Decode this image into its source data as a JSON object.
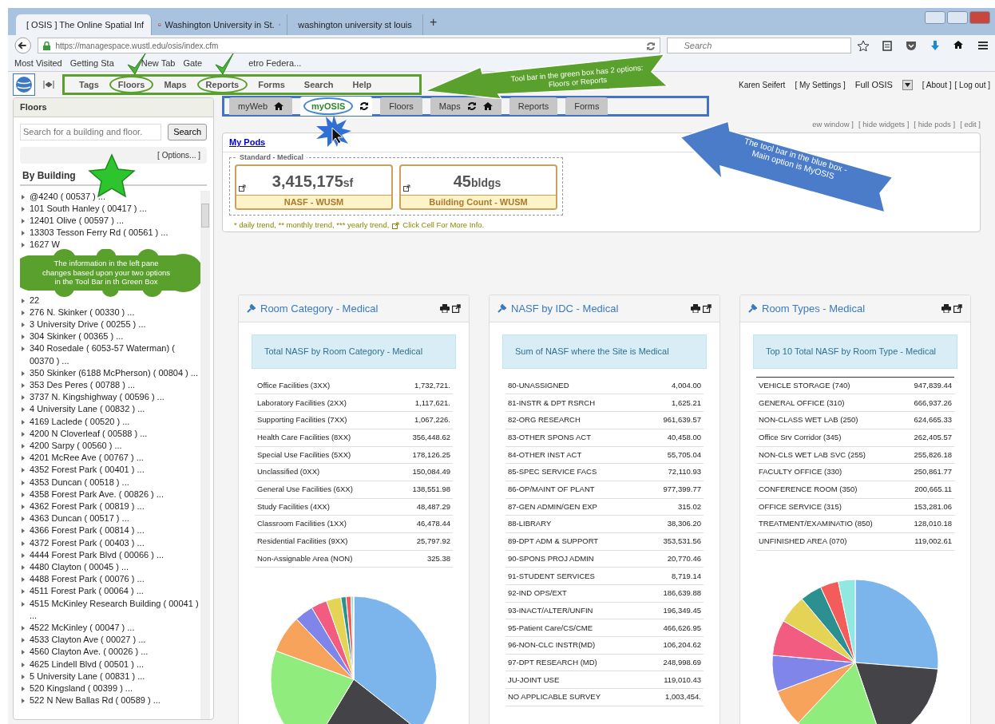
{
  "browser": {
    "tabs": [
      {
        "title": "[ OSIS ] The Online Spatial Inf",
        "selected": true,
        "kind": "globe"
      },
      {
        "title": "Washington University in St.",
        "selected": false,
        "kind": "crest"
      },
      {
        "title": "washington university st louis",
        "selected": false,
        "kind": "yahoo"
      }
    ],
    "new_tab": "+",
    "address": "https://managespace.wustl.edu/osis/index.cfm",
    "search": {
      "placeholder": "Search"
    },
    "bookmarks": [
      "Most Visited",
      "Getting Sta",
      "New Tab",
      "Gate",
      "etro Federa..."
    ]
  },
  "app": {
    "menu": [
      {
        "label": "Tags",
        "highlighted": false
      },
      {
        "label": "Floors",
        "highlighted": true
      },
      {
        "label": "Maps",
        "highlighted": false
      },
      {
        "label": "Reports",
        "highlighted": true
      },
      {
        "label": "Forms",
        "highlighted": false
      },
      {
        "label": "Search",
        "highlighted": false
      },
      {
        "label": "Help",
        "highlighted": false
      }
    ],
    "user": "Karen Seifert",
    "settings": "[ My Settings ]",
    "mode": "Full OSIS",
    "links": [
      "[ About ]",
      "[ Log out ]"
    ]
  },
  "tab_bar": [
    {
      "label": "myWeb",
      "selected": false,
      "home": true
    },
    {
      "label": "myOSIS",
      "selected": true,
      "refresh": true
    },
    {
      "label": "Floors",
      "selected": false
    },
    {
      "label": "Maps",
      "selected": false,
      "refresh": true,
      "home": true
    },
    {
      "label": "Reports",
      "selected": false
    },
    {
      "label": "Forms",
      "selected": false
    }
  ],
  "page_links": [
    "ew window ]",
    "[ hide widgets ]",
    "[ hide pods ]",
    "[ edit ]"
  ],
  "sidebar": {
    "title": "Floors",
    "search": {
      "placeholder": "Search for a building and floor."
    },
    "search_button": "Search",
    "options": "[ Options... ]",
    "heading": "By Building",
    "items": [
      {
        "kind": "building",
        "text": "@4240 ( 00537 ) ..."
      },
      {
        "kind": "building",
        "text": "101 South Hanley ( 00417 ) ..."
      },
      {
        "kind": "building",
        "text": "12401 Olive ( 00597 ) ..."
      },
      {
        "kind": "building",
        "text": "13303 Tesson Ferry Rd ( 00561 ) ..."
      },
      {
        "kind": "building",
        "text": "1627 W"
      },
      {
        "kind": "callout",
        "text": "The information in the left pane changes based upon your two options in the Tool Bar in th Green Box"
      },
      {
        "kind": "building",
        "text": "22"
      },
      {
        "kind": "building",
        "text": "276 N. Skinker ( 00330 ) ..."
      },
      {
        "kind": "building",
        "text": "3 University Drive ( 00255 ) ..."
      },
      {
        "kind": "building",
        "text": "304 Skinker ( 00365 ) ..."
      },
      {
        "kind": "building",
        "text": "340 Rosedale ( 6053-57 Waterman) ( 00370 ) ..."
      },
      {
        "kind": "building",
        "text": "350 Skinker (6188 McPherson) ( 00804 ) ..."
      },
      {
        "kind": "building",
        "text": "353 Des Peres ( 00788 ) ..."
      },
      {
        "kind": "building",
        "text": "3737 N. Kingshighway ( 00596 ) ..."
      },
      {
        "kind": "building",
        "text": "4 University Lane ( 00832 ) ..."
      },
      {
        "kind": "building",
        "text": "4169 Laclede ( 00520 ) ..."
      },
      {
        "kind": "building",
        "text": "4200 N Cloverleaf ( 00588 ) ..."
      },
      {
        "kind": "building",
        "text": "4200 Sarpy ( 00560 ) ..."
      },
      {
        "kind": "building",
        "text": "4201 McRee Ave ( 00767 ) ..."
      },
      {
        "kind": "building",
        "text": "4352 Forest Park ( 00401 ) ..."
      },
      {
        "kind": "building",
        "text": "4353 Duncan ( 00518 ) ..."
      },
      {
        "kind": "building",
        "text": "4358 Forest Park Ave. ( 00826 ) ..."
      },
      {
        "kind": "building",
        "text": "4362 Forest Park ( 00819 ) ..."
      },
      {
        "kind": "building",
        "text": "4363 Duncan ( 00517 ) ..."
      },
      {
        "kind": "building",
        "text": "4366 Forest Park ( 00814 ) ..."
      },
      {
        "kind": "building",
        "text": "4372 Forest Park ( 00403 ) ..."
      },
      {
        "kind": "building",
        "text": "4444 Forest Park Blvd ( 00066 ) ..."
      },
      {
        "kind": "building",
        "text": "4480 Clayton ( 00045 ) ..."
      },
      {
        "kind": "building",
        "text": "4488 Forest Park ( 00076 ) ..."
      },
      {
        "kind": "building",
        "text": "4511 Forest Park ( 00064 ) ..."
      },
      {
        "kind": "building",
        "text": "4515 McKinley Research Building ( 00041 ) ..."
      },
      {
        "kind": "building",
        "text": "4522 McKinley ( 00047 ) ..."
      },
      {
        "kind": "building",
        "text": "4533 Clayton Ave ( 00027 ) ..."
      },
      {
        "kind": "building",
        "text": "4560 Clayton Ave. ( 00026 ) ..."
      },
      {
        "kind": "building",
        "text": "4625 Lindell Blvd ( 00501 ) ..."
      },
      {
        "kind": "building",
        "text": "5 University Lane ( 00831 ) ..."
      },
      {
        "kind": "building",
        "text": "520 Kingsland ( 00399 ) ..."
      },
      {
        "kind": "building",
        "text": "522 N New Ballas Rd ( 00589 ) ..."
      }
    ]
  },
  "pods": {
    "title": "My Pods",
    "group": "Standard - Medical",
    "tiles": [
      {
        "value": "3,415,175",
        "unit": "sf",
        "label": "NASF - WUSM"
      },
      {
        "value": "45",
        "unit": "bldgs",
        "label": "Building Count - WUSM"
      }
    ],
    "footnote": "* daily trend, ** monthly trend, *** yearly trend,",
    "footnote_link": "Click Cell For More Info."
  },
  "widgets": [
    {
      "title": "Room Category - Medical",
      "caption": "Total NASF by Room Category - Medical",
      "kind": "table-pie",
      "rule": false,
      "rows": [
        [
          "Office Facilities (3XX)",
          "1,732,721."
        ],
        [
          "Laboratory Facilities (2XX)",
          "1,117,621."
        ],
        [
          "Supporting Facilities (7XX)",
          "1,067,226."
        ],
        [
          "Health Care Facilities (8XX)",
          "356,448.62"
        ],
        [
          "Special Use Facilities (5XX)",
          "178,126.25"
        ],
        [
          "Unclassified (0XX)",
          "150,084.49"
        ],
        [
          "General Use Facilities (6XX)",
          "138,551.98"
        ],
        [
          "Study Facilities (4XX)",
          "48,487.29"
        ],
        [
          "Classroom Facilities (1XX)",
          "46,478.44"
        ],
        [
          "Residential Facilities (9XX)",
          "25,797.92"
        ],
        [
          "Non-Assignable Area (NON)",
          "325.38"
        ]
      ]
    },
    {
      "title": "NASF by IDC - Medical",
      "caption": "Sum of NASF where the Site is Medical",
      "kind": "table",
      "rule": false,
      "rows": [
        [
          "80-UNASSIGNED",
          "4,004.00"
        ],
        [
          "81-INSTR & DPT RSRCH",
          "1,625.21"
        ],
        [
          "82-ORG RESEARCH",
          "961,639.57"
        ],
        [
          "83-OTHER SPONS ACT",
          "40,458.00"
        ],
        [
          "84-OTHER INST ACT",
          "55,705.04"
        ],
        [
          "85-SPEC SERVICE FACS",
          "72,110.93"
        ],
        [
          "86-OP/MAINT OF PLANT",
          "977,399.77"
        ],
        [
          "87-GEN ADMIN/GEN EXP",
          "315.02"
        ],
        [
          "88-LIBRARY",
          "38,306.20"
        ],
        [
          "89-DPT ADM & SUPPORT",
          "353,531.56"
        ],
        [
          "90-SPONS PROJ ADMIN",
          "20,770.46"
        ],
        [
          "91-STUDENT SERVICES",
          "8,719.14"
        ],
        [
          "92-IND OPS/EXT",
          "186,639.88"
        ],
        [
          "93-INACT/ALTER/UNFIN",
          "196,349.45"
        ],
        [
          "95-Patient Care/CS/CME",
          "466,626.95"
        ],
        [
          "96-NON-CLC INSTR(MD)",
          "106,204.62"
        ],
        [
          "97-DPT RESEARCH (MD)",
          "248,998.69"
        ],
        [
          "JU-JOINT USE",
          "119,010.43"
        ],
        [
          "NO APPLICABLE SURVEY",
          "1,003,454."
        ]
      ]
    },
    {
      "title": "Room Types - Medical",
      "caption": "Top 10 Total NASF by Room Type - Medical",
      "kind": "table-pie",
      "rule": true,
      "rows": [
        [
          "VEHICLE STORAGE (740)",
          "947,839.44"
        ],
        [
          "GENERAL OFFICE (310)",
          "666,937.26"
        ],
        [
          "NON-CLASS WET LAB (250)",
          "624,665.33"
        ],
        [
          "Office Srv Corridor (345)",
          "262,405.57"
        ],
        [
          "NON-CLS WET LAB SVC (255)",
          "255,826.18"
        ],
        [
          "FACULTY OFFICE (330)",
          "250,861.77"
        ],
        [
          "CONFERENCE ROOM (350)",
          "200,665.11"
        ],
        [
          "OFFICE SERVICE (315)",
          "153,281.06"
        ],
        [
          "TREATMENT/EXAMINATIO (850)",
          "128,010.18"
        ],
        [
          "UNFINISHED AREA (070)",
          "119,002.61"
        ]
      ]
    }
  ],
  "annotations": [
    {
      "kind": "arrow-green",
      "text": "Tool bar in the green box has 2 options:  Floors or Reports"
    },
    {
      "kind": "arrow-blue",
      "text": "The tool bar in the blue box - Main option is MyOSIS"
    }
  ]
}
